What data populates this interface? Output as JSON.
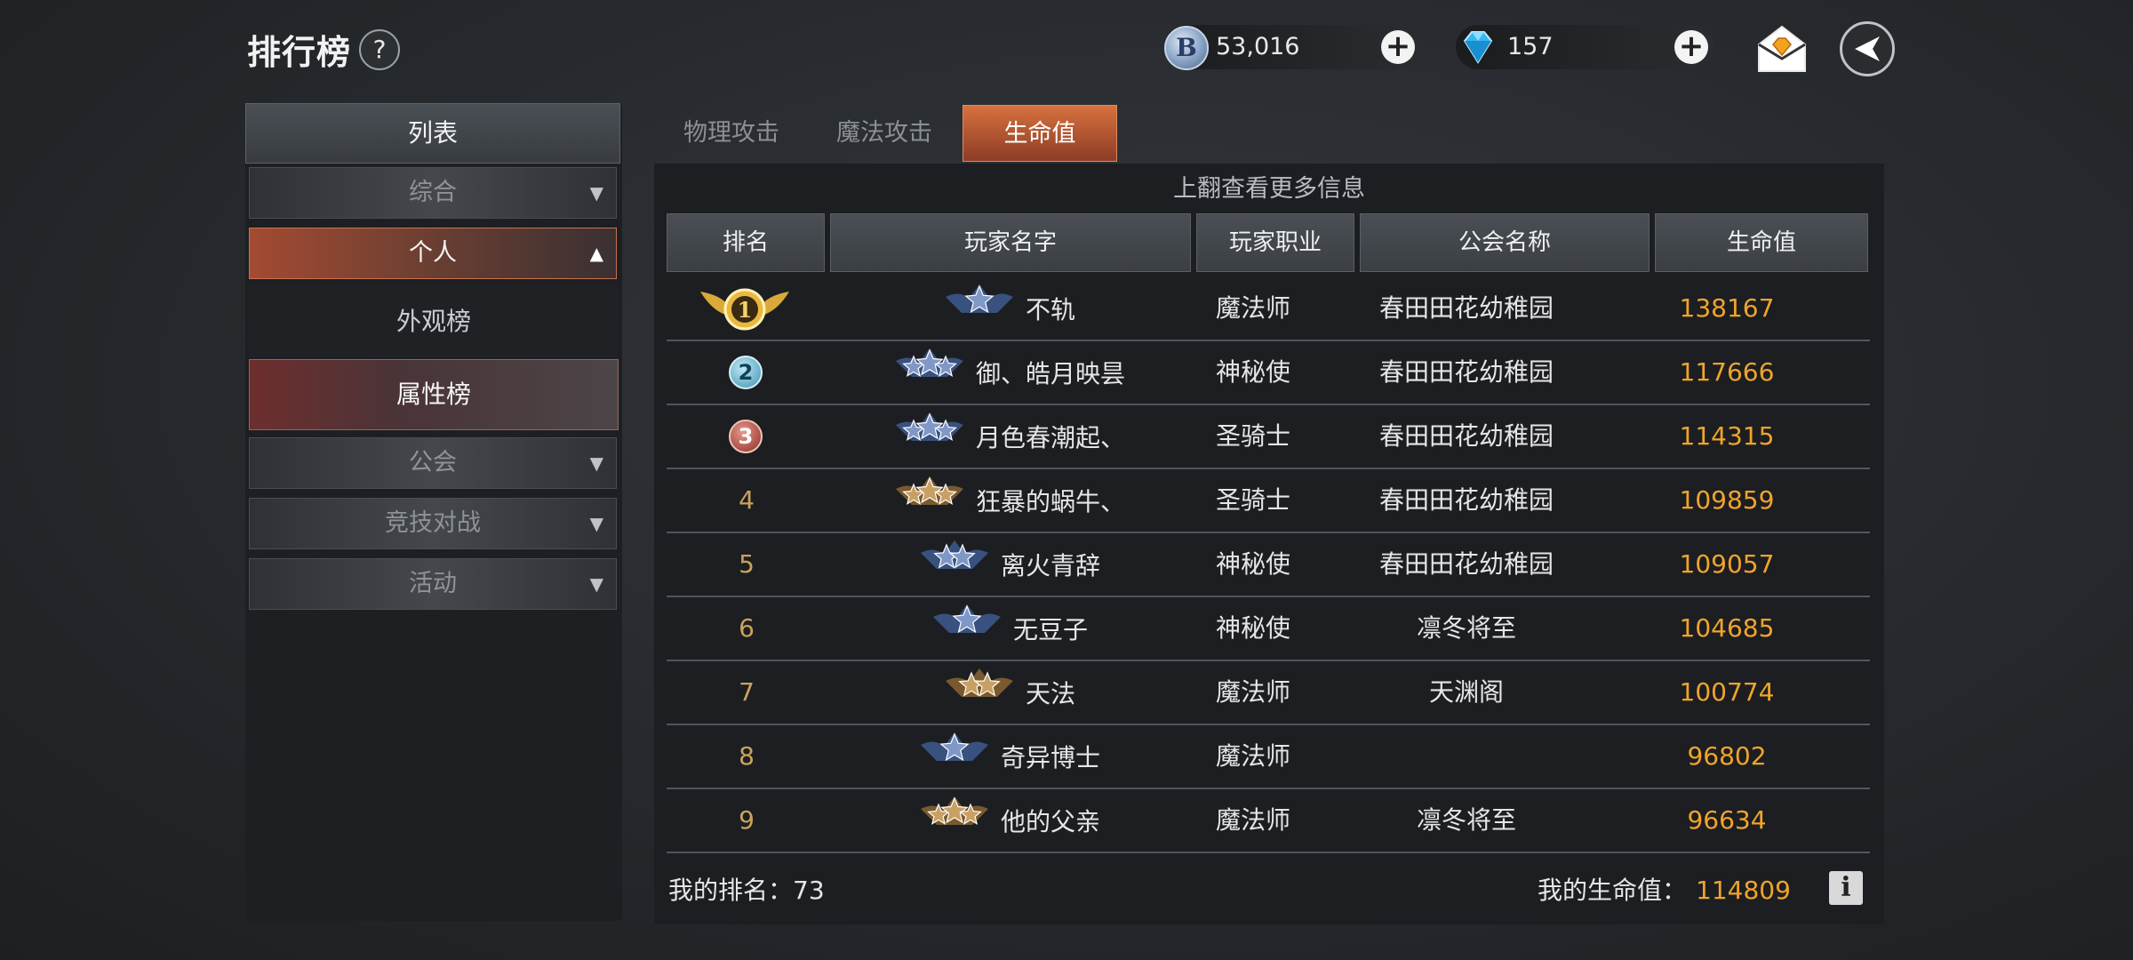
{
  "header": {
    "title": "排行榜",
    "help_label": "?",
    "currency_b": {
      "icon": "b-coin-icon",
      "value": "53,016"
    },
    "currency_diamond": {
      "icon": "diamond-icon",
      "value": "157"
    },
    "mail_icon": "mail-diamond-icon",
    "back_icon": "back-arrow-icon"
  },
  "sidebar": {
    "header": "列表",
    "categories": [
      {
        "label": "综合",
        "state": "collapsed"
      },
      {
        "label": "个人",
        "state": "expanded"
      },
      {
        "label": "公会",
        "state": "collapsed"
      },
      {
        "label": "竞技对战",
        "state": "collapsed"
      },
      {
        "label": "活动",
        "state": "collapsed"
      }
    ],
    "subitems": [
      {
        "label": "外观榜",
        "selected": false
      },
      {
        "label": "属性榜",
        "selected": true
      }
    ]
  },
  "tabs": [
    {
      "label": "物理攻击",
      "active": false
    },
    {
      "label": "魔法攻击",
      "active": false
    },
    {
      "label": "生命值",
      "active": true
    }
  ],
  "table": {
    "scroll_hint": "上翻查看更多信息",
    "columns": [
      "排名",
      "玩家名字",
      "玩家职业",
      "公会名称",
      "生命值"
    ],
    "rows": [
      {
        "rank": "1",
        "badge": "blue-1-star",
        "name": "不轨",
        "job": "魔法师",
        "guild": "春田田花幼稚园",
        "value": "138167"
      },
      {
        "rank": "2",
        "badge": "blue-3-star",
        "name": "御、皓月映昙",
        "job": "神秘使",
        "guild": "春田田花幼稚园",
        "value": "117666"
      },
      {
        "rank": "3",
        "badge": "blue-3-star",
        "name": "月色春潮起、",
        "job": "圣骑士",
        "guild": "春田田花幼稚园",
        "value": "114315"
      },
      {
        "rank": "4",
        "badge": "gold-3-star",
        "name": "狂暴的蜗牛、",
        "job": "圣骑士",
        "guild": "春田田花幼稚园",
        "value": "109859"
      },
      {
        "rank": "5",
        "badge": "blue-2-star",
        "name": "离火青辞",
        "job": "神秘使",
        "guild": "春田田花幼稚园",
        "value": "109057"
      },
      {
        "rank": "6",
        "badge": "blue-1-star",
        "name": "无豆子",
        "job": "神秘使",
        "guild": "凛冬将至",
        "value": "104685"
      },
      {
        "rank": "7",
        "badge": "gold-2-star",
        "name": "天法",
        "job": "魔法师",
        "guild": "天渊阁",
        "value": "100774"
      },
      {
        "rank": "8",
        "badge": "blue-1-star",
        "name": "奇异博士",
        "job": "魔法师",
        "guild": "",
        "value": "96802"
      },
      {
        "rank": "9",
        "badge": "gold-3-star",
        "name": "他的父亲",
        "job": "魔法师",
        "guild": "凛冬将至",
        "value": "96634"
      }
    ]
  },
  "footer": {
    "my_rank_label": "我的排名：",
    "my_rank_value": "73",
    "my_value_label": "我的生命值：",
    "my_value": "114809",
    "info_label": "i"
  },
  "colors": {
    "accent": "#f0a42b",
    "tab_active": "#c9643a",
    "row_divider": "#50555b"
  }
}
